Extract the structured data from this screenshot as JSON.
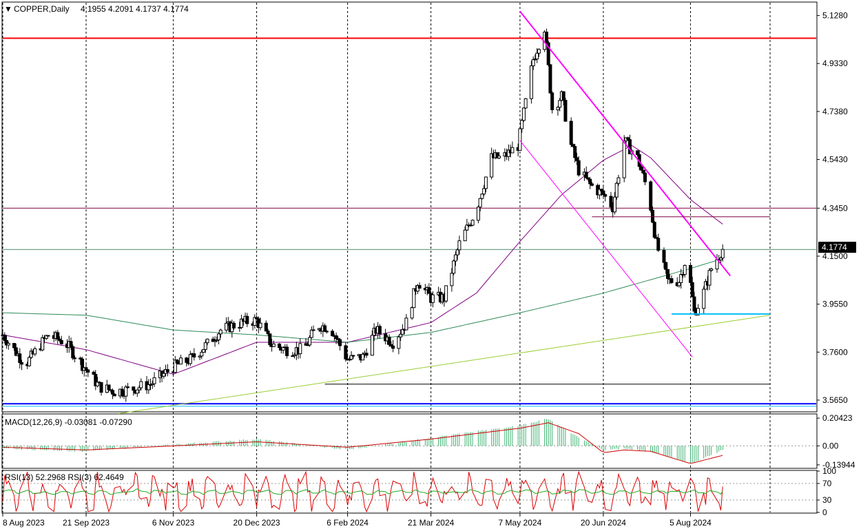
{
  "chart_data": {
    "type": "candlestick",
    "symbol_header": "COPPER,Daily",
    "ohlc_header": "4.1955 4.2091 4.1737 4.1774",
    "last_price": 4.1774,
    "last_price_label": "4.1774",
    "price_axis": {
      "range": [
        3.52,
        5.18
      ],
      "ticks": [
        5.128,
        4.933,
        4.738,
        4.543,
        4.345,
        4.15,
        3.955,
        3.76,
        3.565
      ],
      "tick_labels": [
        "5.1280",
        "4.9330",
        "4.7380",
        "4.5430",
        "4.3450",
        "4.1500",
        "3.9550",
        "3.7600",
        "3.5650"
      ]
    },
    "x_axis": {
      "date_labels": [
        "8 Aug 2023",
        "21 Sep 2023",
        "6 Nov 2023",
        "20 Dec 2023",
        "6 Feb 2024",
        "21 Mar 2024",
        "7 May 2024",
        "20 Jun 2024",
        "5 Aug 2024"
      ],
      "grid_dates": [
        "8 Aug 2023",
        "21 Sep 2023",
        "6 Nov 2023",
        "20 Dec 2023",
        "6 Feb 2024",
        "21 Mar 2024",
        "7 May 2024",
        "20 Jun 2024",
        "5 Aug 2024",
        "16 Sep 2024"
      ]
    },
    "price_anchors": [
      [
        "2023-08-08",
        3.83
      ],
      [
        "2023-08-20",
        3.71
      ],
      [
        "2023-09-01",
        3.83
      ],
      [
        "2023-09-10",
        3.8
      ],
      [
        "2023-09-21",
        3.69
      ],
      [
        "2023-09-28",
        3.62
      ],
      [
        "2023-10-06",
        3.6
      ],
      [
        "2023-10-15",
        3.61
      ],
      [
        "2023-10-25",
        3.63
      ],
      [
        "2023-11-06",
        3.7
      ],
      [
        "2023-11-15",
        3.73
      ],
      [
        "2023-11-25",
        3.8
      ],
      [
        "2023-12-01",
        3.85
      ],
      [
        "2023-12-12",
        3.88
      ],
      [
        "2023-12-20",
        3.89
      ],
      [
        "2023-12-28",
        3.79
      ],
      [
        "2024-01-05",
        3.77
      ],
      [
        "2024-01-14",
        3.77
      ],
      [
        "2024-01-21",
        3.87
      ],
      [
        "2024-01-28",
        3.86
      ],
      [
        "2024-02-06",
        3.73
      ],
      [
        "2024-02-14",
        3.74
      ],
      [
        "2024-02-21",
        3.85
      ],
      [
        "2024-03-01",
        3.8
      ],
      [
        "2024-03-08",
        3.88
      ],
      [
        "2024-03-14",
        4.05
      ],
      [
        "2024-03-21",
        3.98
      ],
      [
        "2024-03-28",
        3.98
      ],
      [
        "2024-04-05",
        4.2
      ],
      [
        "2024-04-14",
        4.34
      ],
      [
        "2024-04-22",
        4.55
      ],
      [
        "2024-04-28",
        4.55
      ],
      [
        "2024-05-06",
        4.6
      ],
      [
        "2024-05-14",
        4.95
      ],
      [
        "2024-05-20",
        5.08
      ],
      [
        "2024-05-24",
        4.75
      ],
      [
        "2024-05-29",
        4.8
      ],
      [
        "2024-06-03",
        4.6
      ],
      [
        "2024-06-07",
        4.5
      ],
      [
        "2024-06-13",
        4.44
      ],
      [
        "2024-06-20",
        4.4
      ],
      [
        "2024-06-25",
        4.35
      ],
      [
        "2024-07-01",
        4.62
      ],
      [
        "2024-07-08",
        4.55
      ],
      [
        "2024-07-14",
        4.4
      ],
      [
        "2024-07-18",
        4.2
      ],
      [
        "2024-07-24",
        4.05
      ],
      [
        "2024-07-30",
        4.05
      ],
      [
        "2024-08-03",
        4.15
      ],
      [
        "2024-08-07",
        3.92
      ],
      [
        "2024-08-11",
        3.98
      ],
      [
        "2024-08-16",
        4.1
      ],
      [
        "2024-08-22",
        4.18
      ]
    ],
    "moving_averages": [
      {
        "color": "#800080",
        "anchors": [
          [
            "2023-08-08",
            3.83
          ],
          [
            "2023-09-21",
            3.77
          ],
          [
            "2023-11-06",
            3.67
          ],
          [
            "2023-12-20",
            3.8
          ],
          [
            "2024-02-06",
            3.8
          ],
          [
            "2024-03-21",
            3.88
          ],
          [
            "2024-04-14",
            4.0
          ],
          [
            "2024-05-07",
            4.21
          ],
          [
            "2024-05-29",
            4.4
          ],
          [
            "2024-06-20",
            4.54
          ],
          [
            "2024-07-05",
            4.6
          ],
          [
            "2024-07-15",
            4.55
          ],
          [
            "2024-08-05",
            4.38
          ],
          [
            "2024-08-22",
            4.28
          ]
        ]
      },
      {
        "color": "#2e8b57",
        "anchors": [
          [
            "2023-08-08",
            3.92
          ],
          [
            "2023-09-21",
            3.91
          ],
          [
            "2023-11-06",
            3.85
          ],
          [
            "2023-12-20",
            3.83
          ],
          [
            "2024-02-06",
            3.8
          ],
          [
            "2024-03-21",
            3.84
          ],
          [
            "2024-05-07",
            3.92
          ],
          [
            "2024-06-20",
            4.0
          ],
          [
            "2024-08-05",
            4.1
          ],
          [
            "2024-08-22",
            4.14
          ]
        ]
      }
    ],
    "horizontal_lines": [
      {
        "price": 5.036,
        "color": "#ff0000",
        "width": 2
      },
      {
        "price": 4.345,
        "color": "#800040",
        "width": 1
      },
      {
        "price": 4.177,
        "color": "#4c8a6a",
        "width": 1
      },
      {
        "price": 3.55,
        "color": "#0000ff",
        "width": 2
      },
      {
        "price": 3.54,
        "color": "#00bfff",
        "width": 1
      }
    ],
    "trend_lines": [
      {
        "from": [
          "2024-05-07",
          5.145
        ],
        "to": [
          "2024-08-26",
          4.07
        ],
        "color": "#ff00ff",
        "width": 2
      },
      {
        "from": [
          "2024-05-07",
          4.62
        ],
        "to": [
          "2024-08-06",
          3.74
        ],
        "color": "#ff00ff",
        "width": 1
      },
      {
        "from": [
          "2023-10-08",
          3.51
        ],
        "to": [
          "2024-09-16",
          3.91
        ],
        "color": "#9acd32",
        "width": 1
      },
      {
        "from": [
          "2024-01-25",
          3.63
        ],
        "to": [
          "2024-09-16",
          3.63
        ],
        "color": "#000000",
        "width": 1
      },
      {
        "from": [
          "2024-06-14",
          4.31
        ],
        "to": [
          "2024-09-16",
          4.31
        ],
        "color": "#800040",
        "width": 1
      },
      {
        "from": [
          "2024-07-26",
          3.915
        ],
        "to": [
          "2024-09-16",
          3.915
        ],
        "color": "#00bfff",
        "width": 2
      }
    ],
    "macd": {
      "label": "MACD(12,26,9) -0.03081 -0.07290",
      "params": "12,26,9",
      "main": -0.03081,
      "signal": -0.0729,
      "range": [
        -0.16,
        0.23
      ],
      "ticks": [
        0.20423,
        0.0,
        -0.13944
      ],
      "tick_labels": [
        "0.20423",
        "0.00",
        "-0.13944"
      ],
      "hist_anchors": [
        [
          "2023-08-08",
          -0.02
        ],
        [
          "2023-09-21",
          -0.04
        ],
        [
          "2023-11-06",
          0.01
        ],
        [
          "2023-12-20",
          0.05
        ],
        [
          "2024-02-06",
          -0.03
        ],
        [
          "2024-03-21",
          0.06
        ],
        [
          "2024-05-07",
          0.15
        ],
        [
          "2024-05-22",
          0.2
        ],
        [
          "2024-06-07",
          0.06
        ],
        [
          "2024-06-20",
          -0.03
        ],
        [
          "2024-07-01",
          -0.02
        ],
        [
          "2024-07-15",
          -0.04
        ],
        [
          "2024-08-05",
          -0.13
        ],
        [
          "2024-08-22",
          -0.03
        ]
      ],
      "signal_anchors": [
        [
          "2023-08-08",
          -0.01
        ],
        [
          "2023-09-21",
          -0.03
        ],
        [
          "2023-11-06",
          0.0
        ],
        [
          "2023-12-20",
          0.03
        ],
        [
          "2024-02-06",
          -0.01
        ],
        [
          "2024-03-21",
          0.05
        ],
        [
          "2024-05-07",
          0.13
        ],
        [
          "2024-05-22",
          0.17
        ],
        [
          "2024-06-07",
          0.09
        ],
        [
          "2024-06-20",
          -0.05
        ],
        [
          "2024-07-01",
          -0.03
        ],
        [
          "2024-07-15",
          -0.04
        ],
        [
          "2024-08-05",
          -0.13
        ],
        [
          "2024-08-22",
          -0.07
        ]
      ]
    },
    "rsi": {
      "label": "RSI(13) 52.2968  RSI(3) 62.4649",
      "rsi13": 52.2968,
      "rsi3": 62.4649,
      "range": [
        0,
        100
      ],
      "ticks": [
        100,
        70,
        30,
        0
      ],
      "tick_labels": [
        "100",
        "70",
        "30",
        "0"
      ],
      "rsi13_color": "#22aa22",
      "rsi3_color": "#dd0000"
    }
  }
}
